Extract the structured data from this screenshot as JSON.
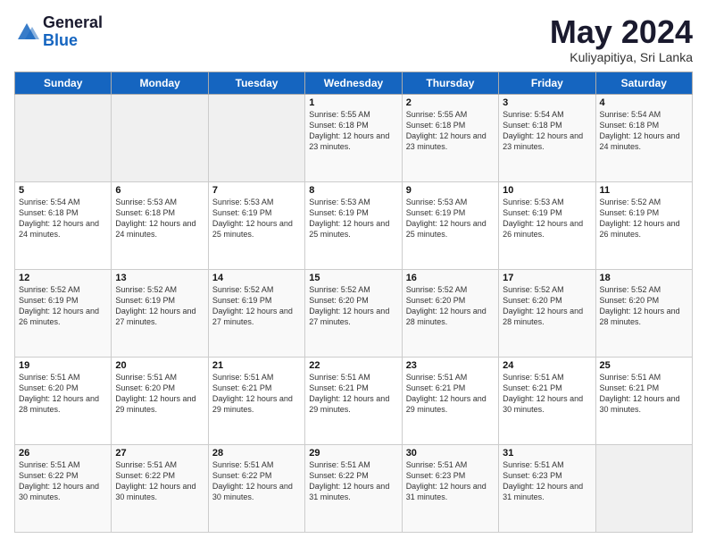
{
  "logo": {
    "general": "General",
    "blue": "Blue"
  },
  "header": {
    "month": "May 2024",
    "location": "Kuliyapitiya, Sri Lanka"
  },
  "weekdays": [
    "Sunday",
    "Monday",
    "Tuesday",
    "Wednesday",
    "Thursday",
    "Friday",
    "Saturday"
  ],
  "weeks": [
    [
      {
        "day": "",
        "sunrise": "",
        "sunset": "",
        "daylight": ""
      },
      {
        "day": "",
        "sunrise": "",
        "sunset": "",
        "daylight": ""
      },
      {
        "day": "",
        "sunrise": "",
        "sunset": "",
        "daylight": ""
      },
      {
        "day": "1",
        "sunrise": "Sunrise: 5:55 AM",
        "sunset": "Sunset: 6:18 PM",
        "daylight": "Daylight: 12 hours and 23 minutes."
      },
      {
        "day": "2",
        "sunrise": "Sunrise: 5:55 AM",
        "sunset": "Sunset: 6:18 PM",
        "daylight": "Daylight: 12 hours and 23 minutes."
      },
      {
        "day": "3",
        "sunrise": "Sunrise: 5:54 AM",
        "sunset": "Sunset: 6:18 PM",
        "daylight": "Daylight: 12 hours and 23 minutes."
      },
      {
        "day": "4",
        "sunrise": "Sunrise: 5:54 AM",
        "sunset": "Sunset: 6:18 PM",
        "daylight": "Daylight: 12 hours and 24 minutes."
      }
    ],
    [
      {
        "day": "5",
        "sunrise": "Sunrise: 5:54 AM",
        "sunset": "Sunset: 6:18 PM",
        "daylight": "Daylight: 12 hours and 24 minutes."
      },
      {
        "day": "6",
        "sunrise": "Sunrise: 5:53 AM",
        "sunset": "Sunset: 6:18 PM",
        "daylight": "Daylight: 12 hours and 24 minutes."
      },
      {
        "day": "7",
        "sunrise": "Sunrise: 5:53 AM",
        "sunset": "Sunset: 6:19 PM",
        "daylight": "Daylight: 12 hours and 25 minutes."
      },
      {
        "day": "8",
        "sunrise": "Sunrise: 5:53 AM",
        "sunset": "Sunset: 6:19 PM",
        "daylight": "Daylight: 12 hours and 25 minutes."
      },
      {
        "day": "9",
        "sunrise": "Sunrise: 5:53 AM",
        "sunset": "Sunset: 6:19 PM",
        "daylight": "Daylight: 12 hours and 25 minutes."
      },
      {
        "day": "10",
        "sunrise": "Sunrise: 5:53 AM",
        "sunset": "Sunset: 6:19 PM",
        "daylight": "Daylight: 12 hours and 26 minutes."
      },
      {
        "day": "11",
        "sunrise": "Sunrise: 5:52 AM",
        "sunset": "Sunset: 6:19 PM",
        "daylight": "Daylight: 12 hours and 26 minutes."
      }
    ],
    [
      {
        "day": "12",
        "sunrise": "Sunrise: 5:52 AM",
        "sunset": "Sunset: 6:19 PM",
        "daylight": "Daylight: 12 hours and 26 minutes."
      },
      {
        "day": "13",
        "sunrise": "Sunrise: 5:52 AM",
        "sunset": "Sunset: 6:19 PM",
        "daylight": "Daylight: 12 hours and 27 minutes."
      },
      {
        "day": "14",
        "sunrise": "Sunrise: 5:52 AM",
        "sunset": "Sunset: 6:19 PM",
        "daylight": "Daylight: 12 hours and 27 minutes."
      },
      {
        "day": "15",
        "sunrise": "Sunrise: 5:52 AM",
        "sunset": "Sunset: 6:20 PM",
        "daylight": "Daylight: 12 hours and 27 minutes."
      },
      {
        "day": "16",
        "sunrise": "Sunrise: 5:52 AM",
        "sunset": "Sunset: 6:20 PM",
        "daylight": "Daylight: 12 hours and 28 minutes."
      },
      {
        "day": "17",
        "sunrise": "Sunrise: 5:52 AM",
        "sunset": "Sunset: 6:20 PM",
        "daylight": "Daylight: 12 hours and 28 minutes."
      },
      {
        "day": "18",
        "sunrise": "Sunrise: 5:52 AM",
        "sunset": "Sunset: 6:20 PM",
        "daylight": "Daylight: 12 hours and 28 minutes."
      }
    ],
    [
      {
        "day": "19",
        "sunrise": "Sunrise: 5:51 AM",
        "sunset": "Sunset: 6:20 PM",
        "daylight": "Daylight: 12 hours and 28 minutes."
      },
      {
        "day": "20",
        "sunrise": "Sunrise: 5:51 AM",
        "sunset": "Sunset: 6:20 PM",
        "daylight": "Daylight: 12 hours and 29 minutes."
      },
      {
        "day": "21",
        "sunrise": "Sunrise: 5:51 AM",
        "sunset": "Sunset: 6:21 PM",
        "daylight": "Daylight: 12 hours and 29 minutes."
      },
      {
        "day": "22",
        "sunrise": "Sunrise: 5:51 AM",
        "sunset": "Sunset: 6:21 PM",
        "daylight": "Daylight: 12 hours and 29 minutes."
      },
      {
        "day": "23",
        "sunrise": "Sunrise: 5:51 AM",
        "sunset": "Sunset: 6:21 PM",
        "daylight": "Daylight: 12 hours and 29 minutes."
      },
      {
        "day": "24",
        "sunrise": "Sunrise: 5:51 AM",
        "sunset": "Sunset: 6:21 PM",
        "daylight": "Daylight: 12 hours and 30 minutes."
      },
      {
        "day": "25",
        "sunrise": "Sunrise: 5:51 AM",
        "sunset": "Sunset: 6:21 PM",
        "daylight": "Daylight: 12 hours and 30 minutes."
      }
    ],
    [
      {
        "day": "26",
        "sunrise": "Sunrise: 5:51 AM",
        "sunset": "Sunset: 6:22 PM",
        "daylight": "Daylight: 12 hours and 30 minutes."
      },
      {
        "day": "27",
        "sunrise": "Sunrise: 5:51 AM",
        "sunset": "Sunset: 6:22 PM",
        "daylight": "Daylight: 12 hours and 30 minutes."
      },
      {
        "day": "28",
        "sunrise": "Sunrise: 5:51 AM",
        "sunset": "Sunset: 6:22 PM",
        "daylight": "Daylight: 12 hours and 30 minutes."
      },
      {
        "day": "29",
        "sunrise": "Sunrise: 5:51 AM",
        "sunset": "Sunset: 6:22 PM",
        "daylight": "Daylight: 12 hours and 31 minutes."
      },
      {
        "day": "30",
        "sunrise": "Sunrise: 5:51 AM",
        "sunset": "Sunset: 6:23 PM",
        "daylight": "Daylight: 12 hours and 31 minutes."
      },
      {
        "day": "31",
        "sunrise": "Sunrise: 5:51 AM",
        "sunset": "Sunset: 6:23 PM",
        "daylight": "Daylight: 12 hours and 31 minutes."
      },
      {
        "day": "",
        "sunrise": "",
        "sunset": "",
        "daylight": ""
      }
    ]
  ]
}
